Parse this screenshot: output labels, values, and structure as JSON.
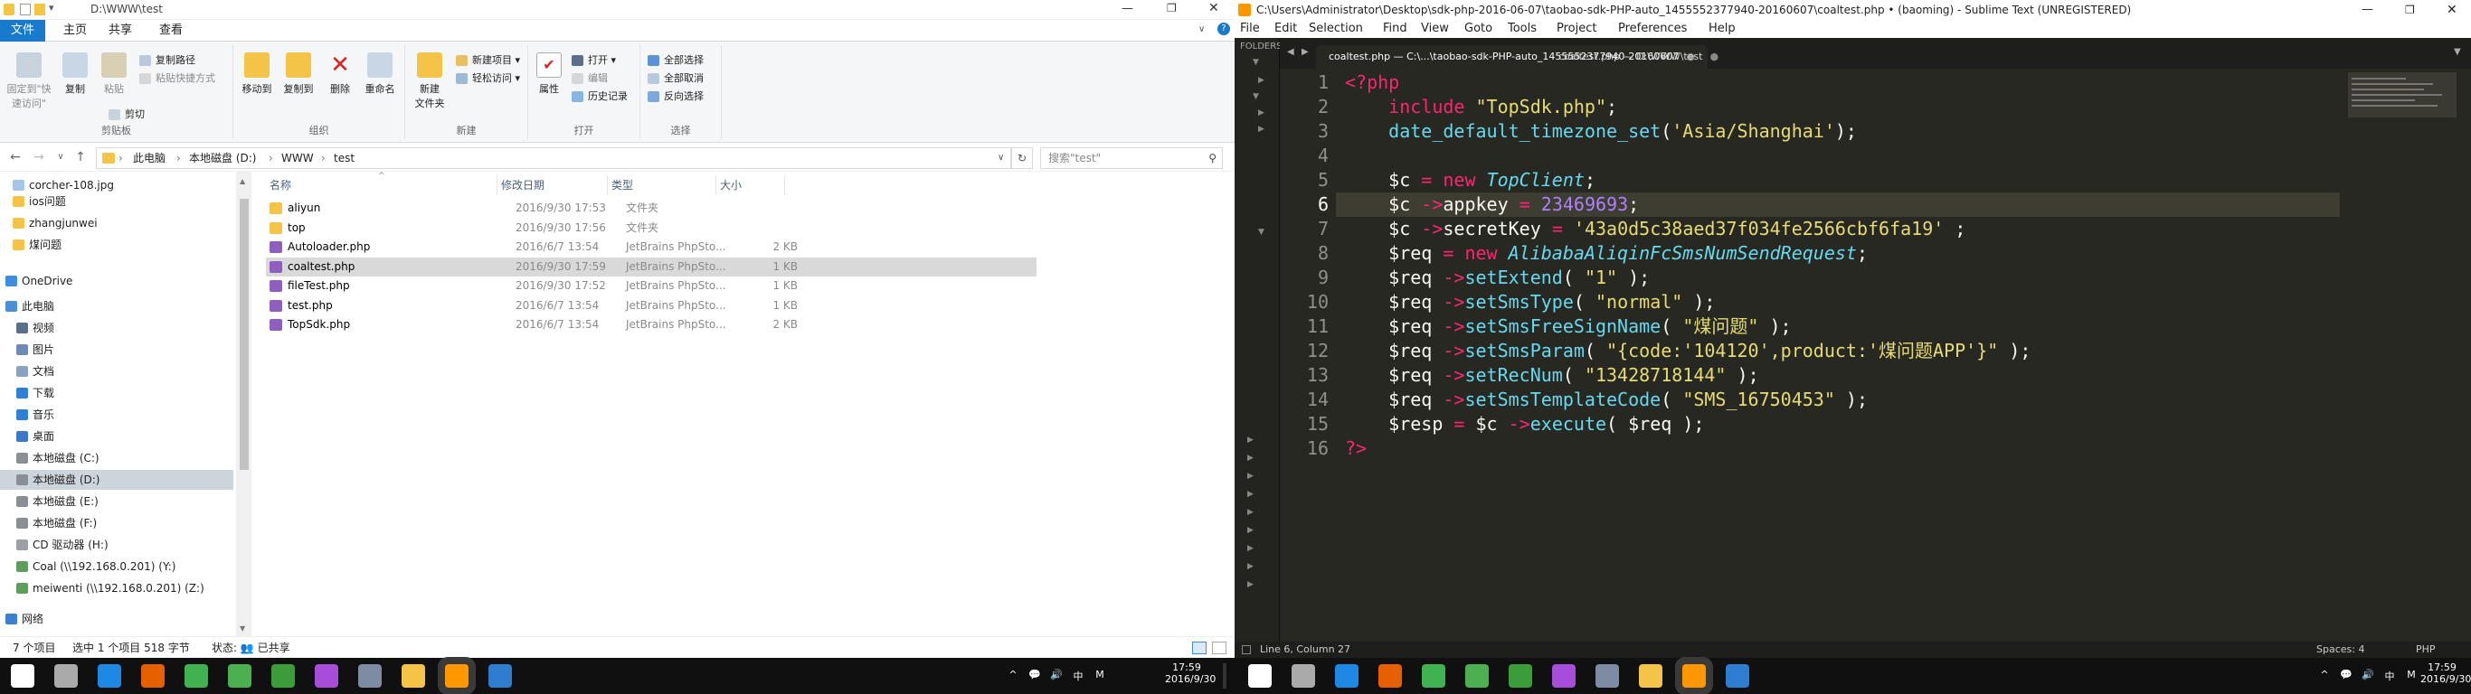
{
  "explorer": {
    "title": "D:\\WWW\\test",
    "tabs": [
      "文件",
      "主页",
      "共享",
      "查看"
    ],
    "ribbon": {
      "clipboard": {
        "label": "剪贴板",
        "pin": "固定到\"快\n速访问\"",
        "copy": "复制",
        "paste": "粘贴",
        "copy_path": "复制路径",
        "paste_shortcut": "粘贴快捷方式",
        "cut": "剪切"
      },
      "organize": {
        "label": "组织",
        "move_to": "移动到",
        "copy_to": "复制到",
        "delete": "删除",
        "rename": "重命名"
      },
      "new": {
        "label": "新建",
        "new_folder": "新建\n文件夹",
        "new_item": "新建项目 ▾",
        "easy_access": "轻松访问 ▾"
      },
      "open": {
        "label": "打开",
        "properties": "属性",
        "open": "打开 ▾",
        "edit": "编辑",
        "history": "历史记录"
      },
      "select": {
        "label": "选择",
        "select_all": "全部选择",
        "select_none": "全部取消",
        "invert": "反向选择"
      }
    },
    "address": {
      "path": [
        "此电脑",
        "本地磁盘 (D:)",
        "WWW",
        "test"
      ],
      "search_placeholder": "搜索\"test\""
    },
    "nav": [
      {
        "label": "corcher-108.jpg",
        "icon": "image-icon"
      },
      {
        "label": "ios问题",
        "icon": "folder-icon"
      },
      {
        "label": "zhangjunwei",
        "icon": "folder-icon"
      },
      {
        "label": "煤问题",
        "icon": "folder-icon"
      },
      {
        "label": "OneDrive",
        "icon": "cloud-icon"
      },
      {
        "label": "此电脑",
        "icon": "computer-icon"
      },
      {
        "label": "视频",
        "icon": "video-icon"
      },
      {
        "label": "图片",
        "icon": "pictures-icon"
      },
      {
        "label": "文档",
        "icon": "documents-icon"
      },
      {
        "label": "下载",
        "icon": "download-icon"
      },
      {
        "label": "音乐",
        "icon": "music-icon"
      },
      {
        "label": "桌面",
        "icon": "desktop-icon"
      },
      {
        "label": "本地磁盘 (C:)",
        "icon": "drive-icon"
      },
      {
        "label": "本地磁盘 (D:)",
        "icon": "drive-icon",
        "selected": true
      },
      {
        "label": "本地磁盘 (E:)",
        "icon": "drive-icon"
      },
      {
        "label": "本地磁盘 (F:)",
        "icon": "drive-icon"
      },
      {
        "label": "CD 驱动器 (H:)",
        "icon": "cd-icon"
      },
      {
        "label": "Coal (\\\\192.168.0.201) (Y:)",
        "icon": "network-drive-icon"
      },
      {
        "label": "meiwenti (\\\\192.168.0.201) (Z:)",
        "icon": "network-drive-icon"
      },
      {
        "label": "网络",
        "icon": "network-icon"
      }
    ],
    "columns": [
      "名称",
      "修改日期",
      "类型",
      "大小"
    ],
    "files": [
      {
        "name": "aliyun",
        "date": "2016/9/30 17:53",
        "type": "文件夹",
        "size": ""
      },
      {
        "name": "top",
        "date": "2016/9/30 17:56",
        "type": "文件夹",
        "size": ""
      },
      {
        "name": "Autoloader.php",
        "date": "2016/6/7 13:54",
        "type": "JetBrains PhpSto...",
        "size": "2 KB"
      },
      {
        "name": "coaltest.php",
        "date": "2016/9/30 17:59",
        "type": "JetBrains PhpSto...",
        "size": "1 KB",
        "selected": true
      },
      {
        "name": "fileTest.php",
        "date": "2016/9/30 17:52",
        "type": "JetBrains PhpSto...",
        "size": "1 KB"
      },
      {
        "name": "test.php",
        "date": "2016/6/7 13:54",
        "type": "JetBrains PhpSto...",
        "size": "1 KB"
      },
      {
        "name": "TopSdk.php",
        "date": "2016/6/7 13:54",
        "type": "JetBrains PhpSto...",
        "size": "2 KB"
      }
    ],
    "status": {
      "count": "7 个项目",
      "selected": "选中 1 个项目  518 字节",
      "state": "状态: 👥 已共享"
    }
  },
  "sublime": {
    "title": "C:\\Users\\Administrator\\Desktop\\sdk-php-2016-06-07\\taobao-sdk-PHP-auto_1455552377940-20160607\\coaltest.php • (baoming) - Sublime Text (UNREGISTERED)",
    "menu": [
      "File",
      "Edit",
      "Selection",
      "Find",
      "View",
      "Goto",
      "Tools",
      "Project",
      "Preferences",
      "Help"
    ],
    "sidebar_label": "FOLDERS",
    "tabs": [
      {
        "label": "coaltest.php — C:\\...\\taobao-sdk-PHP-auto_1455552377940-20160607",
        "active": true
      },
      {
        "label": "coaltest.php — D:\\WWW\\test",
        "active": false
      }
    ],
    "line_numbers": [
      "1",
      "2",
      "3",
      "4",
      "5",
      "6",
      "7",
      "8",
      "9",
      "10",
      "11",
      "12",
      "13",
      "14",
      "15",
      "16"
    ],
    "current_line": 6,
    "code": {
      "l1": "<?php",
      "l2_kw": "include",
      "l2_str": "\"TopSdk.php\"",
      "l3_fn": "date_default_timezone_set",
      "l3_str": "'Asia/Shanghai'",
      "l5_cls": "TopClient",
      "l6_prop": "appkey",
      "l6_num": "23469693",
      "l7_prop": "secretKey",
      "l7_str": "'43a0d5c38aed37f034fe2566cbf6fa19'",
      "l8_cls": "AlibabaAliqinFcSmsNumSendRequest",
      "l9_m": "setExtend",
      "l9_s": "\"1\"",
      "l10_m": "setSmsType",
      "l10_s": "\"normal\"",
      "l11_m": "setSmsFreeSignName",
      "l11_s": "\"煤问题\"",
      "l12_m": "setSmsParam",
      "l12_s": "\"{code:'104120',product:'煤问题APP'}\"",
      "l13_m": "setRecNum",
      "l13_s": "\"13428718144\"",
      "l14_m": "setSmsTemplateCode",
      "l14_s": "\"SMS_16750453\"",
      "l15_m": "execute",
      "l16": "?>"
    },
    "status": {
      "position": "Line 6, Column 27",
      "spaces": "Spaces: 4",
      "syntax": "PHP"
    }
  },
  "taskbar": {
    "left_clock": {
      "time": "17:59",
      "date": "2016/9/30"
    },
    "right_clock": {
      "time": "17:59",
      "date": "2016/9/30"
    },
    "tray": [
      "^",
      "💬",
      "🔊",
      "中",
      "M"
    ]
  }
}
